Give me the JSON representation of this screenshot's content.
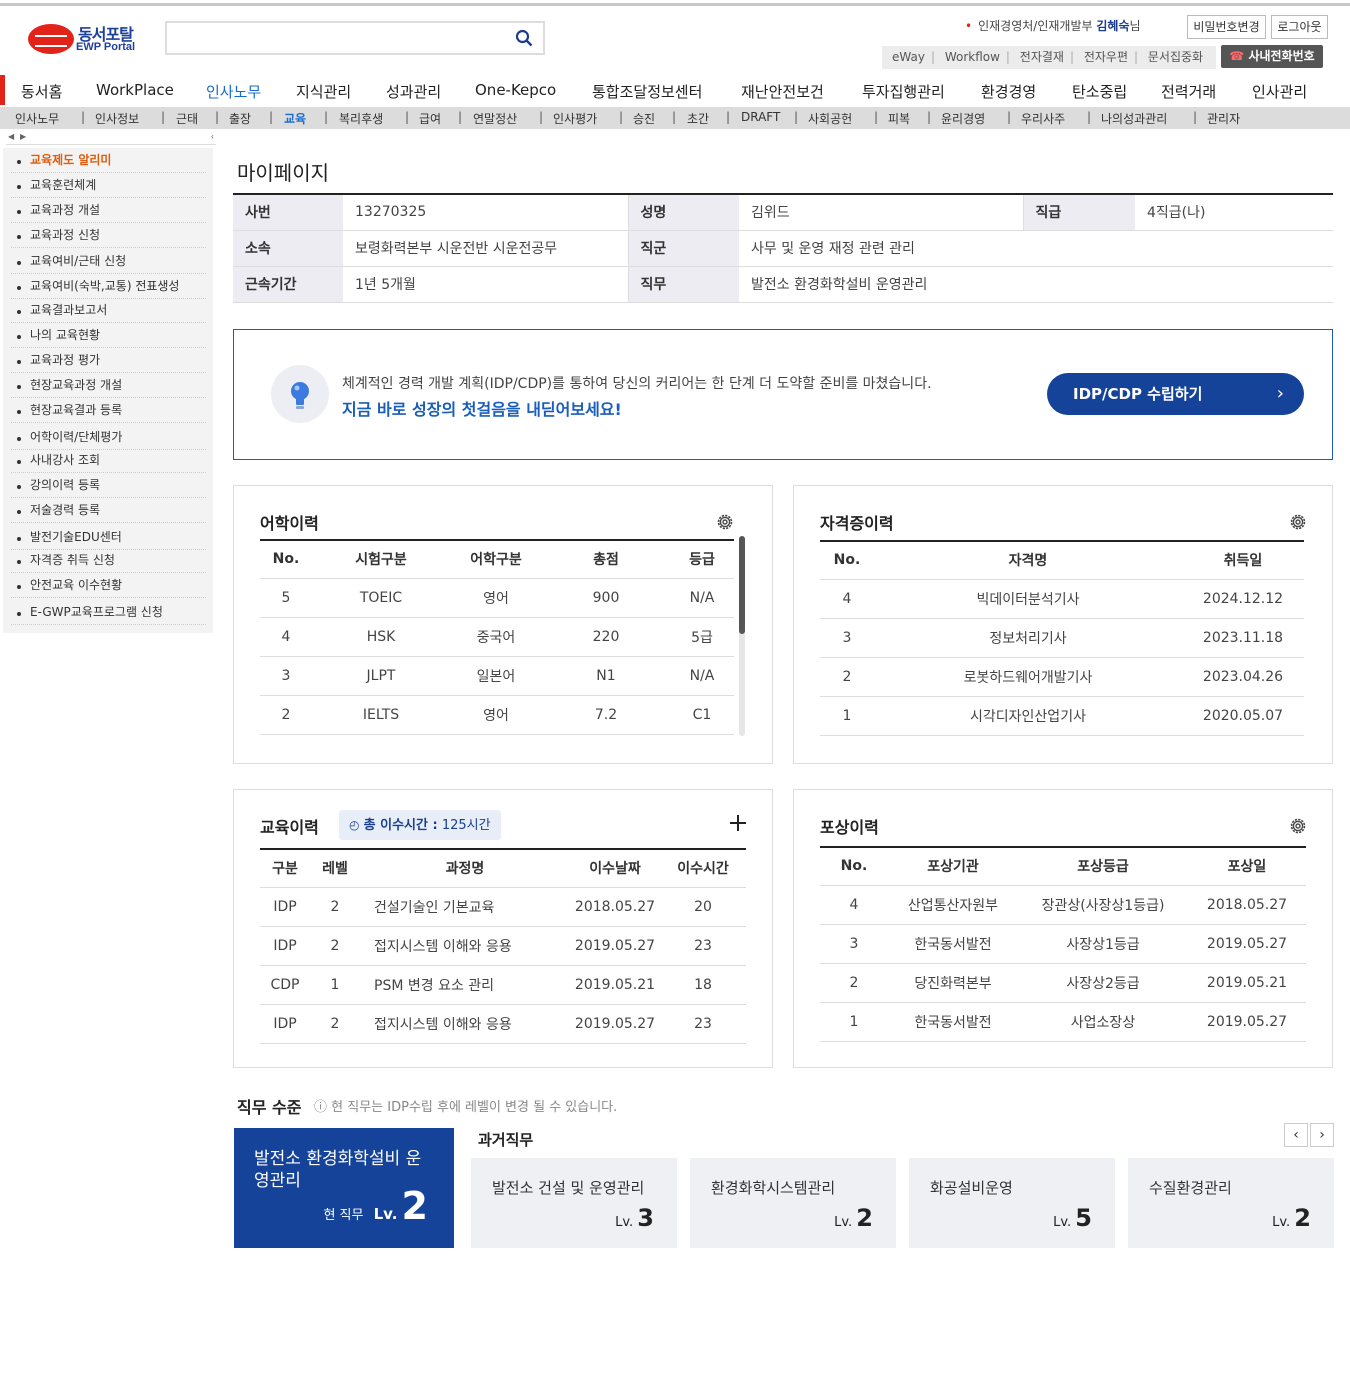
{
  "header": {
    "logo_kr": "동서포탈",
    "logo_en": "EWP Portal",
    "user_dept": "인재경영처/인재개발부",
    "user_name": "김혜숙",
    "user_suffix": "님",
    "change_pw": "비밀번호변경",
    "logout": "로그아웃",
    "quick_links": [
      "eWay",
      "Workflow",
      "전자결재",
      "전자우편",
      "문서집중화"
    ],
    "phone_btn": "사내전화번호"
  },
  "main_nav": [
    "동서홈",
    "WorkPlace",
    "인사노무",
    "지식관리",
    "성과관리",
    "One-Kepco",
    "통합조달정보센터",
    "재난안전보건",
    "투자집행관리",
    "환경경영",
    "탄소중립",
    "전력거래",
    "인사관리"
  ],
  "main_nav_active": "인사노무",
  "sub_nav": [
    "인사노무",
    "인사정보",
    "근태",
    "출장",
    "교육",
    "복리후생",
    "급여",
    "연말정산",
    "인사평가",
    "승진",
    "초간",
    "DRAFT",
    "사회공헌",
    "피복",
    "윤리경영",
    "우리사주",
    "나의성과관리",
    "관리자"
  ],
  "sub_nav_active": "교육",
  "side_menu": [
    "교육제도 알리미",
    "교육훈련체계",
    "교육과정 개설",
    "교육과정 신청",
    "교육여비/근태 신청",
    "교육여비(숙박,교통) 전표생성",
    "교육결과보고서",
    "나의 교육현황",
    "교육과정 평가",
    "현장교육과정 개설",
    "현장교육결과 등록",
    "어학이력/단체평가",
    "사내강사 조회",
    "강의이력 등록",
    "저술경력 등록",
    "발전기술EDU센터",
    "자격증 취득 신청",
    "안전교육 이수현황",
    "E-GWP교육프로그램 신청"
  ],
  "page_title": "마이페이지",
  "profile": {
    "emp_no_label": "사번",
    "emp_no": "13270325",
    "name_label": "성명",
    "name": "김위드",
    "grade_label": "직급",
    "grade": "4직급(나)",
    "dept_label": "소속",
    "dept": "보령화력본부 시운전반 시운전공무",
    "jobgroup_label": "직군",
    "jobgroup": "사무 및 운영 재정 관련 관리",
    "tenure_label": "근속기간",
    "tenure": "1년 5개월",
    "duty_label": "직무",
    "duty": "발전소 환경화학설비 운영관리"
  },
  "banner": {
    "line1": "체계적인 경력 개발 계획(IDP/CDP)를 통하여 당신의 커리어는 한 단계 더 도약할 준비를 마쳤습니다.",
    "line2": "지금 바로 성장의 첫걸음을 내딛어보세요!",
    "cta": "IDP/CDP 수립하기"
  },
  "language": {
    "title": "어학이력",
    "columns": [
      "No.",
      "시험구분",
      "어학구분",
      "총점",
      "등급"
    ],
    "rows": [
      [
        "5",
        "TOEIC",
        "영어",
        "900",
        "N/A"
      ],
      [
        "4",
        "HSK",
        "중국어",
        "220",
        "5급"
      ],
      [
        "3",
        "JLPT",
        "일본어",
        "N1",
        "N/A"
      ],
      [
        "2",
        "IELTS",
        "영어",
        "7.2",
        "C1"
      ]
    ]
  },
  "license": {
    "title": "자격증이력",
    "columns": [
      "No.",
      "자격명",
      "취득일"
    ],
    "rows": [
      [
        "4",
        "빅데이터분석기사",
        "2024.12.12"
      ],
      [
        "3",
        "정보처리기사",
        "2023.11.18"
      ],
      [
        "2",
        "로봇하드웨어개발기사",
        "2023.04.26"
      ],
      [
        "1",
        "시각디자인산업기사",
        "2020.05.07"
      ]
    ]
  },
  "education": {
    "title": "교육이력",
    "total_label": "총 이수시간 :",
    "total_value": "125시간",
    "columns": [
      "구분",
      "레벨",
      "과정명",
      "이수날짜",
      "이수시간"
    ],
    "rows": [
      [
        "IDP",
        "2",
        "건설기술인 기본교육",
        "2018.05.27",
        "20"
      ],
      [
        "IDP",
        "2",
        "접지시스템 이해와 응용",
        "2019.05.27",
        "23"
      ],
      [
        "CDP",
        "1",
        "PSM 변경 요소 관리",
        "2019.05.21",
        "18"
      ],
      [
        "IDP",
        "2",
        "접지시스템 이해와 응용",
        "2019.05.27",
        "23"
      ]
    ]
  },
  "award": {
    "title": "포상이력",
    "columns": [
      "No.",
      "포상기관",
      "포상등급",
      "포상일"
    ],
    "rows": [
      [
        "4",
        "산업통산자원부",
        "장관상(사장상1등급)",
        "2018.05.27"
      ],
      [
        "3",
        "한국동서발전",
        "사장상1등급",
        "2019.05.27"
      ],
      [
        "2",
        "당진화력본부",
        "사장상2등급",
        "2019.05.21"
      ],
      [
        "1",
        "한국동서발전",
        "사업소장상",
        "2019.05.27"
      ]
    ]
  },
  "job_level": {
    "title": "직무 수준",
    "note": "현 직무는 IDP수립 후에 레벨이 변경 될 수 있습니다.",
    "current_name": "발전소 환경화학설비 운영관리",
    "current_label": "현 직무",
    "lv_prefix": "Lv.",
    "current_level": "2",
    "past_title": "과거직무",
    "past": [
      {
        "name": "발전소 건설 및 운영관리",
        "level": "3"
      },
      {
        "name": "환경화학시스템관리",
        "level": "2"
      },
      {
        "name": "화공설비운영",
        "level": "5"
      },
      {
        "name": "수질환경관리",
        "level": "2"
      }
    ]
  },
  "colors": {
    "accent": "#15439a",
    "brand_red": "#e2231a",
    "active_link": "#1a6bd1",
    "side_active": "#e05c0c"
  }
}
